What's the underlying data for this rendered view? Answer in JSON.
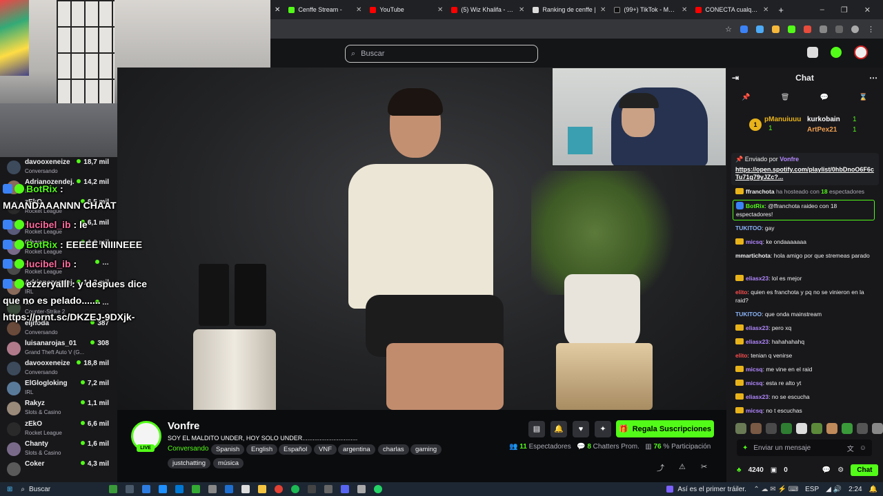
{
  "browser": {
    "tabs": [
      {
        "label": "Cenffe Stream -",
        "color": "#53fc18"
      },
      {
        "label": "YouTube",
        "color": "#ff0000"
      },
      {
        "label": "(5) Wiz Khalifa - Say",
        "color": "#ff0000"
      },
      {
        "label": "Ranking de cenffe |",
        "color": "#dddddd"
      },
      {
        "label": "(99+) TikTok - Make",
        "color": "#111111"
      },
      {
        "label": "CONECTA cualquier",
        "color": "#ff0000"
      }
    ],
    "new_tab": "+",
    "window_controls": [
      "–",
      "❐",
      "✕"
    ]
  },
  "site": {
    "search_placeholder": "Buscar"
  },
  "sidebar": {
    "channels": [
      {
        "name": "davooxeneize",
        "category": "Conversando",
        "viewers": "18,7 mil"
      },
      {
        "name": "Adrianozendej.",
        "category": "IRL",
        "viewers": "14,2 mil"
      },
      {
        "name": "zEkO",
        "category": "Rocket League",
        "viewers": "6,5 mil"
      },
      {
        "name": "…",
        "category": "Rocket League",
        "viewers": "6,1 mil"
      },
      {
        "name": "Chanty",
        "category": "Rocket League",
        "viewers": "1,9 mil"
      },
      {
        "name": "…",
        "category": "Rocket League",
        "viewers": "…"
      },
      {
        "name": "Adrianozendej.",
        "category": "IRL",
        "viewers": "14,2 mil"
      },
      {
        "name": "…",
        "category": "Counter-Strike 2",
        "viewers": "…"
      },
      {
        "name": "eljhoda",
        "category": "Conversando",
        "viewers": "387"
      },
      {
        "name": "luisanarojas_01",
        "category": "Grand Theft Auto V (G...",
        "viewers": "308"
      },
      {
        "name": "davooxeneize",
        "category": "Conversando",
        "viewers": "18,8 mil"
      },
      {
        "name": "ElGlogloking",
        "category": "IRL",
        "viewers": "7,2 mil"
      },
      {
        "name": "Rakyz",
        "category": "Slots & Casino",
        "viewers": "1,1 mil"
      },
      {
        "name": "zEkO",
        "category": "Rocket League",
        "viewers": "6,6 mil"
      },
      {
        "name": "Chanty",
        "category": "Slots & Casino",
        "viewers": "1,6 mil"
      },
      {
        "name": "Coker",
        "category": "",
        "viewers": "4,3 mil"
      }
    ]
  },
  "overlay_chat": [
    {
      "user": "BotRix",
      "text": ":",
      "color": "#53fc18"
    },
    {
      "user": "",
      "text": "MAANDAAANNN CHAAT",
      "color": "#ffffff"
    },
    {
      "user": "lucibel_ib",
      "text": ": le",
      "color": "#ff6b9e"
    },
    {
      "user": "BotRix",
      "text": ": EEEEE NIIINEEE",
      "color": "#53fc18"
    },
    {
      "user": "lucibel_ib",
      "text": ":",
      "color": "#ff6b9e"
    },
    {
      "user": "ezzeryalll",
      "text": ": y despues dice",
      "color": "#ffffff"
    },
    {
      "user": "",
      "text": "que no es pelado.......",
      "color": "#ffffff"
    },
    {
      "user": "",
      "text": "https://prnt.sc/DKZEJ-9DXjk-",
      "color": "#ffffff"
    }
  ],
  "stream": {
    "streamer": "Vonfre",
    "live": "LIVE",
    "title": "SOY EL MALDITO UNDER, HOY SOLO UNDER................................",
    "category": "Conversando",
    "tags": [
      "Spanish",
      "English",
      "Español",
      "VNF",
      "argentina",
      "charlas",
      "gaming",
      "justchatting",
      "música"
    ],
    "subscribe_label": "Regala Suscripciones",
    "viewers": "11",
    "viewers_label": "Espectadores",
    "chatters": "8",
    "chatters_label": "Chatters Prom.",
    "participation": "76",
    "participation_label": "% Participación"
  },
  "chat": {
    "title": "Chat",
    "top_gifters": [
      {
        "rank": "1",
        "name": "pManuiuuu",
        "count": "1"
      },
      {
        "rank": "",
        "name": "kurkobain",
        "count": "1"
      },
      {
        "rank": "",
        "name": "ArtPex21",
        "count": "1"
      }
    ],
    "pinned_by_label": "Enviado por",
    "pinned_by": "Vonfre",
    "pinned_link": "https://open.spotify.com/playlist/0hbDnoO6F6cTu71g79yJZc?...",
    "host_notice_user": "ffranchota",
    "host_notice_text": "ha hosteado con",
    "host_notice_count": "18",
    "host_notice_suffix": "espectadores",
    "raid_user": "BotRix",
    "raid_text": "@ffranchota raideo con 18 espectadores!",
    "messages": [
      {
        "user": "TUKITOO",
        "text": "gay",
        "color": "#8ab4f8",
        "badge": false
      },
      {
        "user": "micsq",
        "text": "ke ondaaaaaaa",
        "color": "#b388ff",
        "badge": true
      },
      {
        "user": "mmartichota",
        "text": "hola amigo por que stremeas parado",
        "color": "#efeff1",
        "badge": false
      },
      {
        "user": "eliasx23",
        "text": "lol es mejor",
        "color": "#b388ff",
        "badge": true
      },
      {
        "user": "elito",
        "text": "quien es franchota y pq no se vinieron en la raid?",
        "color": "#ff4d4d",
        "badge": false
      },
      {
        "user": "TUKITOO",
        "text": "que onda mainstream",
        "color": "#8ab4f8",
        "badge": false
      },
      {
        "user": "eliasx23",
        "text": "pero xq",
        "color": "#b388ff",
        "badge": true
      },
      {
        "user": "eliasx23",
        "text": "hahahahahq",
        "color": "#b388ff",
        "badge": true
      },
      {
        "user": "elito",
        "text": "tenian q venirse",
        "color": "#ff4d4d",
        "badge": false
      },
      {
        "user": "micsq",
        "text": "me vine en el raid",
        "color": "#b388ff",
        "badge": true
      },
      {
        "user": "micsq",
        "text": "esta re alto yt",
        "color": "#b388ff",
        "badge": true
      },
      {
        "user": "eliasx23",
        "text": "no se escucha",
        "color": "#b388ff",
        "badge": true
      },
      {
        "user": "micsq",
        "text": "no t escuchas",
        "color": "#b388ff",
        "badge": true
      }
    ],
    "input_placeholder": "Enviar un mensaje",
    "points": "4240",
    "gifts": "0",
    "send_label": "Chat"
  },
  "taskbar": {
    "search": "Buscar",
    "now_playing": "Así es el primer tráiler...",
    "lang": "ESP",
    "time": "2:24"
  }
}
